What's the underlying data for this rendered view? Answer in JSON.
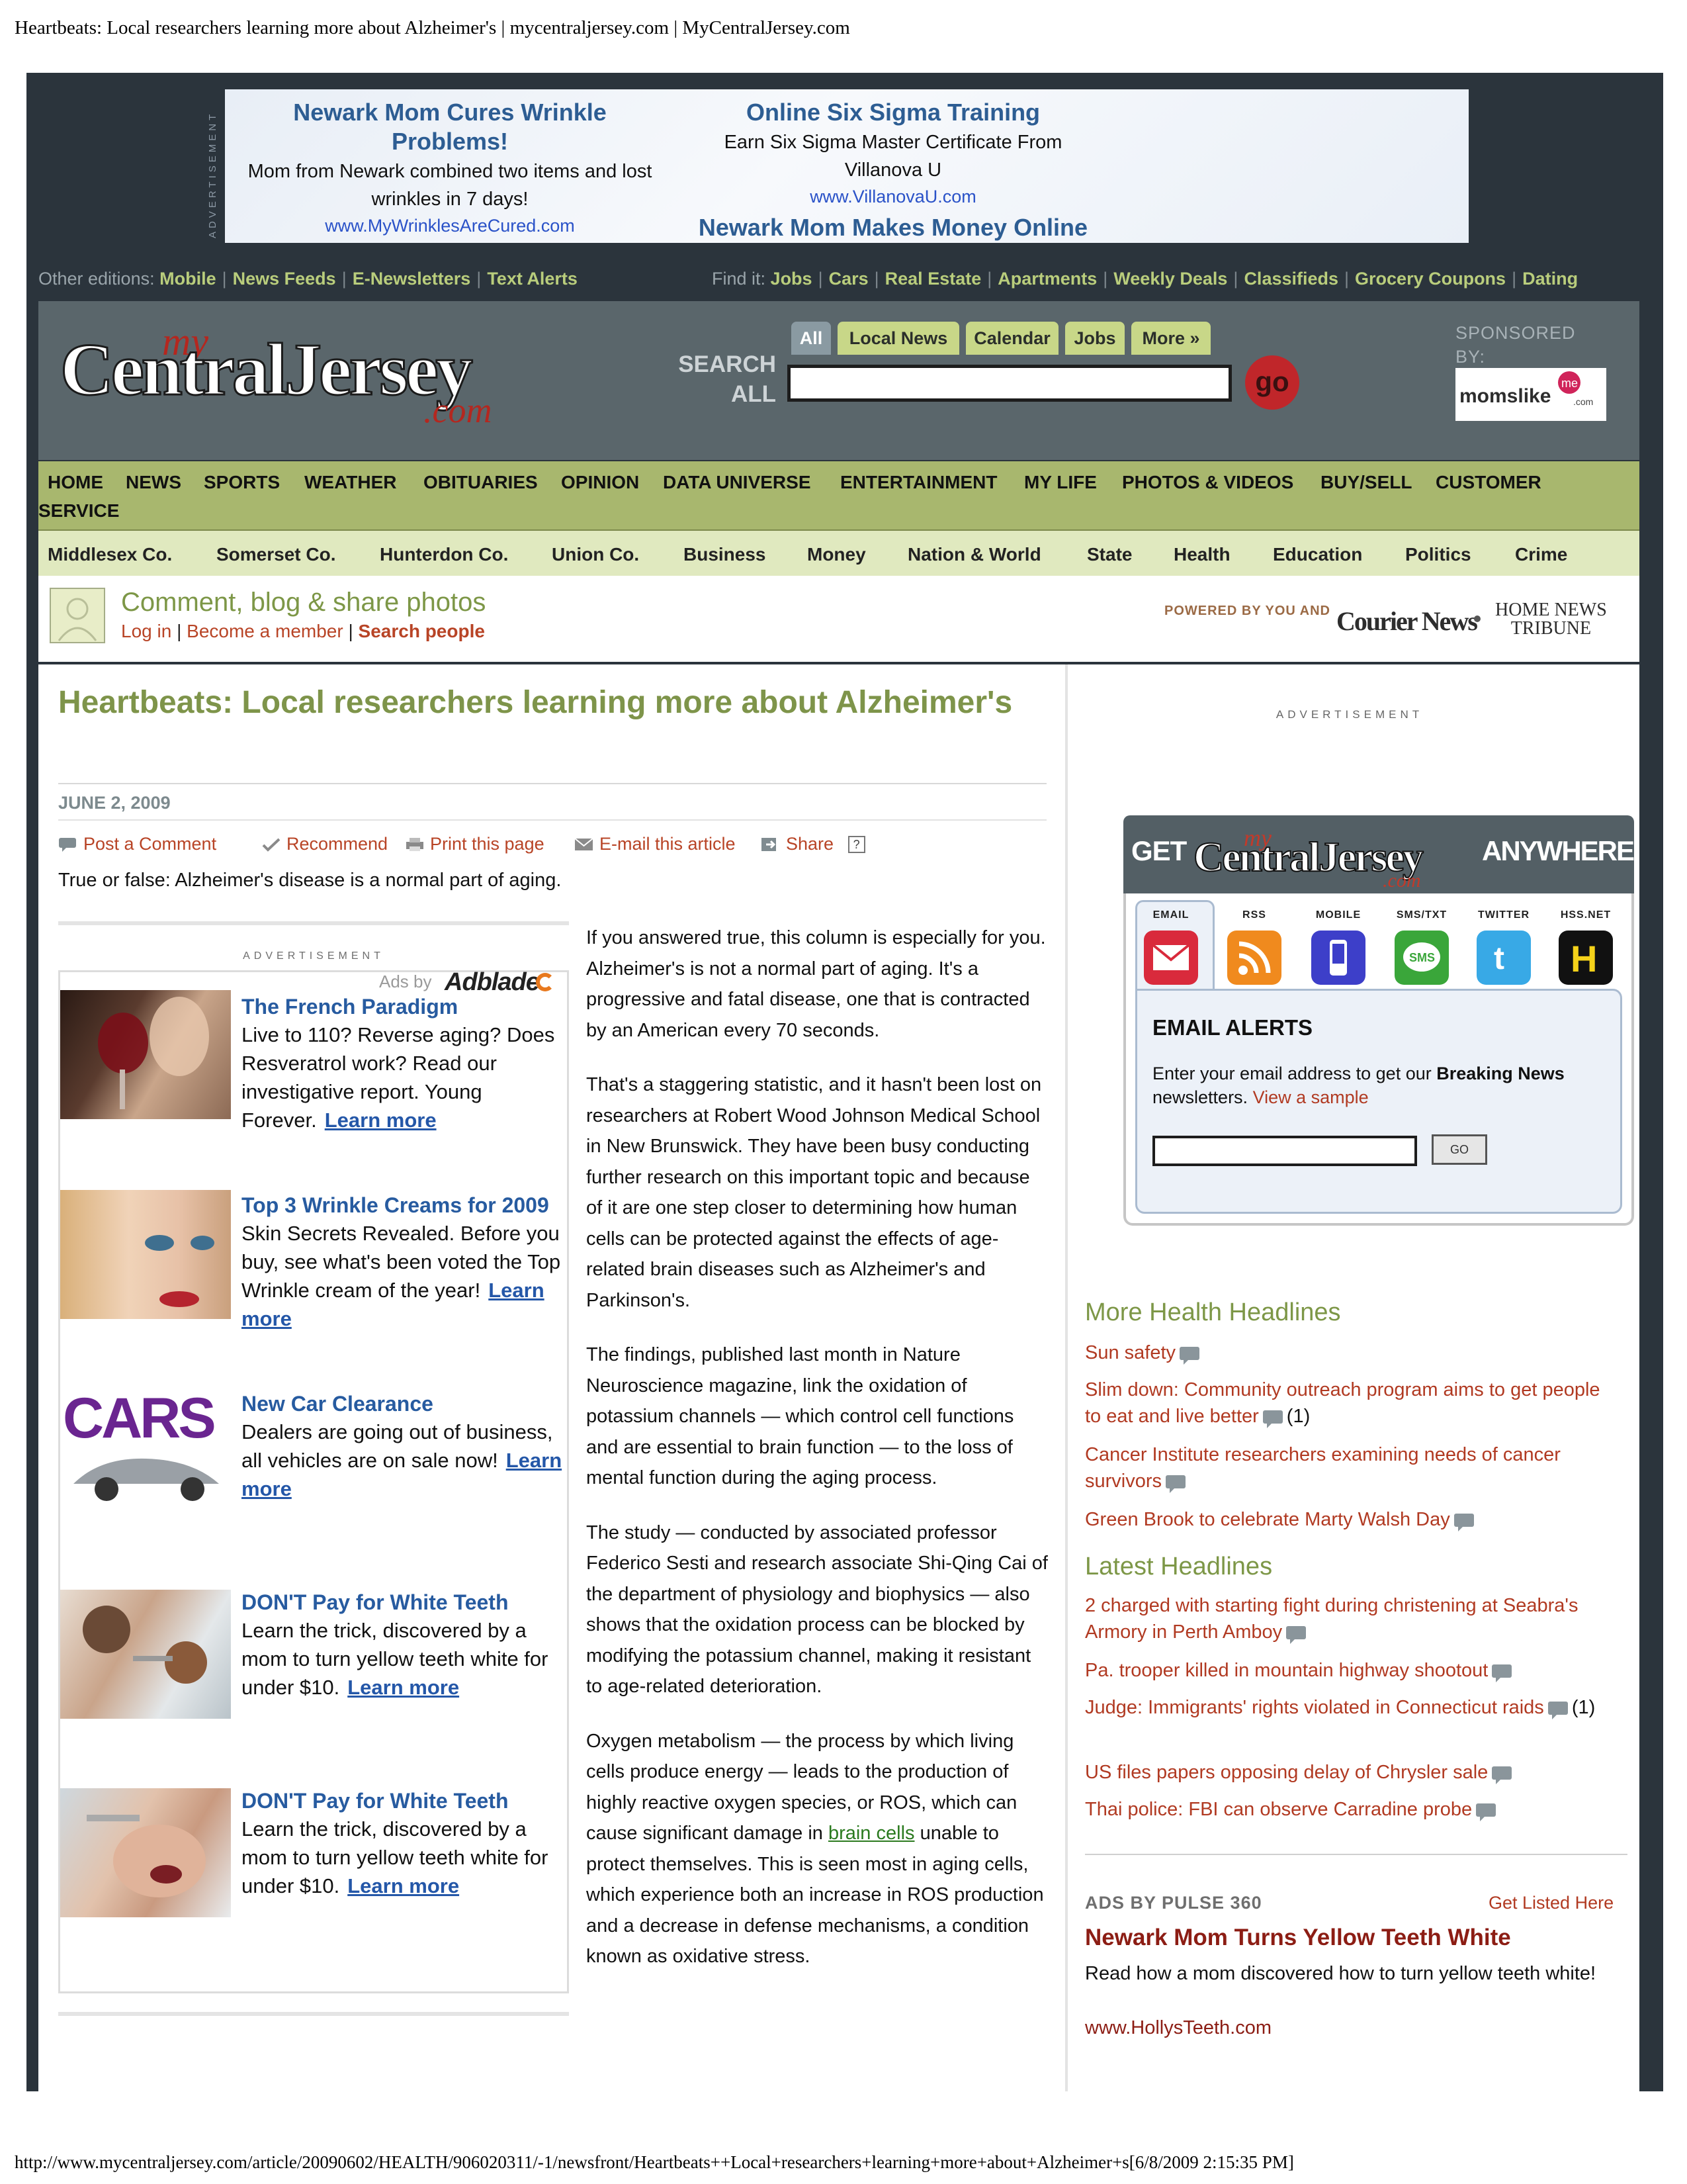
{
  "print": {
    "title": "Heartbeats: Local researchers learning more about Alzheimer's | mycentraljersey.com | MyCentralJersey.com",
    "footer": "http://www.mycentraljersey.com/article/20090602/HEALTH/906020311/-1/newsfront/Heartbeats++Local+researchers+learning+more+about+Alzheimer+s[6/8/2009 2:15:35 PM]"
  },
  "top_ad": {
    "tag": "ADVERTISEMENT",
    "ads": [
      {
        "title": "Newark Mom Cures Wrinkle Problems!",
        "body": "Mom from Newark combined two items and lost wrinkles in 7 days!",
        "url": "www.MyWrinklesAreCured.com"
      },
      {
        "title": "Online Six Sigma Training",
        "body": "Earn Six Sigma Master Certificate From Villanova U",
        "url": "www.VillanovaU.com"
      },
      {
        "title": "Newark Mom Makes Money Online"
      }
    ]
  },
  "editions": {
    "label": "Other editions:",
    "links": [
      "Mobile",
      "News Feeds",
      "E-Newsletters",
      "Text Alerts"
    ],
    "find_label": "Find it:",
    "find_links": [
      "Jobs",
      "Cars",
      "Real Estate",
      "Apartments",
      "Weekly Deals",
      "Classifieds",
      "Grocery Coupons",
      "Dating"
    ]
  },
  "header": {
    "logo_my": "my",
    "logo_main": "CentralJersey",
    "logo_com": ".com",
    "search_label_1": "SEARCH",
    "search_label_2": "ALL",
    "search_tabs": [
      "All",
      "Local News",
      "Calendar",
      "Jobs",
      "More »"
    ],
    "search_placeholder": "",
    "go_label": "go",
    "sponsored_1": "SPONSORED",
    "sponsored_2": "BY:",
    "sponsor_logo": "momslike",
    "sponsor_logo_me": "me",
    "sponsor_logo_com": ".com"
  },
  "main_nav": [
    "HOME",
    "NEWS",
    "SPORTS",
    "WEATHER",
    "OBITUARIES",
    "OPINION",
    "DATA UNIVERSE",
    "ENTERTAINMENT",
    "MY LIFE",
    "PHOTOS & VIDEOS",
    "BUY/SELL",
    "CUSTOMER",
    "SERVICE"
  ],
  "sub_nav": [
    "Middlesex Co.",
    "Somerset Co.",
    "Hunterdon Co.",
    "Union Co.",
    "Business",
    "Money",
    "Nation & World",
    "State",
    "Health",
    "Education",
    "Politics",
    "Crime"
  ],
  "community": {
    "title": "Comment, blog & share photos",
    "login": "Log in",
    "become": "Become a member",
    "search_people": "Search people",
    "powered": "POWERED BY YOU AND",
    "courier": "Courier News",
    "home_news_1": "HOME NEWS",
    "home_news_2": "TRIBUNE"
  },
  "article": {
    "title": "Heartbeats: Local researchers learning more about Alzheimer's",
    "date": "JUNE 2, 2009",
    "tools": [
      "Post a Comment",
      "Recommend",
      "Print this page",
      "E-mail this article",
      "Share"
    ],
    "share_help": "?",
    "intro": "True or false: Alzheimer's disease is a normal part of aging.",
    "paragraphs": [
      "If you answered true, this column is especially for you. Alzheimer's is not a normal part of aging. It's a progressive and fatal disease, one that is contracted by an American every 70 seconds.",
      "That's a staggering statistic, and it hasn't been lost on researchers at Robert Wood Johnson Medical School in New Brunswick. They have been busy conducting further research on this important topic and because of it are one step closer to determining how human cells can be protected against the effects of age-related brain diseases such as Alzheimer's and Parkinson's.",
      "The findings, published last month in Nature Neuroscience magazine, link the oxidation of potassium channels — which control cell functions and are essential to brain function — to the loss of mental function during the aging process.",
      "The study — conducted by associated professor Federico Sesti and research associate Shi-Qing Cai of the department of physiology and biophysics — also shows that the oxidation process can be blocked by modifying the potassium channel, making it resistant to age-related deterioration."
    ],
    "last_paragraph_pre": "Oxygen metabolism — the process by which living cells produce energy — leads to the production of highly reactive oxygen species, or ROS, which can cause significant damage in ",
    "last_paragraph_link": "brain cells",
    "last_paragraph_post": " unable to protect themselves. This is seen most in aging cells, which experience both an increase in ROS production and a decrease in defense mechanisms, a condition known as oxidative stress."
  },
  "left_ads": {
    "tag": "ADVERTISEMENT",
    "ads_by": "Ads by",
    "brand": "Adblade",
    "learn_more": "Learn more",
    "items": [
      {
        "title": "The French Paradigm",
        "text": "Live to 110? Reverse aging? Does Resveratrol work? Read our investigative report. Young Forever."
      },
      {
        "title": "Top 3 Wrinkle Creams for 2009",
        "text": "Skin Secrets Revealed. Before you buy, see what's been voted the Top Wrinkle cream of the year!"
      },
      {
        "title": "New Car Clearance",
        "text": "Dealers are going out of business, all vehicles are on sale now!",
        "thumb_text": "CARS"
      },
      {
        "title": "DON'T Pay for White Teeth",
        "text": "Learn the trick, discovered by a mom to turn yellow teeth white for under $10."
      },
      {
        "title": "DON'T Pay for White Teeth",
        "text": "Learn the trick, discovered by a mom to turn yellow teeth white for under $10."
      }
    ]
  },
  "right": {
    "ad_tag": "ADVERTISEMENT",
    "anywhere_get": "GET",
    "anywhere_any": "ANYWHERE",
    "channels": [
      "EMAIL",
      "RSS",
      "MOBILE",
      "SMS/TXT",
      "TWITTER",
      "HSS.NET"
    ],
    "sms_icon": "SMS",
    "hss_icon": "H",
    "alerts_title": "EMAIL ALERTS",
    "alerts_text_pre": "Enter your email address to get our ",
    "alerts_text_bold": "Breaking News",
    "alerts_text_post": " newsletters. ",
    "alerts_sample": "View a sample",
    "alerts_go": "GO",
    "more_health_title": "More Health Headlines",
    "more_health": [
      {
        "text": "Sun safety",
        "count": ""
      },
      {
        "text": "Slim down: Community outreach program aims to get people to eat and live better",
        "count": "(1)"
      },
      {
        "text": "Cancer Institute researchers examining needs of cancer survivors",
        "count": ""
      },
      {
        "text": "Green Brook to celebrate Marty Walsh Day",
        "count": ""
      }
    ],
    "latest_title": "Latest Headlines",
    "latest": [
      {
        "text": "2 charged with starting fight during christening at Seabra's Armory in Perth Amboy",
        "count": ""
      },
      {
        "text": "Pa. trooper killed in mountain highway shootout",
        "count": ""
      },
      {
        "text": "Judge: Immigrants' rights violated in Connecticut raids",
        "count": "(1)"
      },
      {
        "text": "US files papers opposing delay of Chrysler sale",
        "count": ""
      },
      {
        "text": "Thai police: FBI can observe Carradine probe",
        "count": ""
      }
    ],
    "pulse_label": "ADS BY PULSE 360",
    "get_listed": "Get Listed Here",
    "pulse_title": "Newark Mom Turns Yellow Teeth White",
    "pulse_text": "Read how a mom discovered how to turn yellow teeth white!",
    "pulse_url": "www.HollysTeeth.com"
  },
  "colors": {
    "frame": "#2b343c",
    "header": "#5a666b",
    "nav": "#a8b76e",
    "subnav": "#e0e9bf",
    "title_green": "#7e944a",
    "link_red": "#b13a22",
    "ad_blue": "#275ba0"
  }
}
